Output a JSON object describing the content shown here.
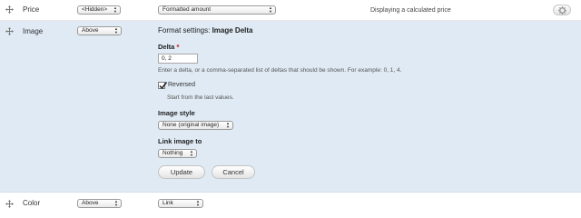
{
  "rows": {
    "price": {
      "label": "Price",
      "label_display": "<Hidden>",
      "formatter": "Formatted amount",
      "summary": "Displaying a calculated price",
      "settings_icon": "gear-icon"
    },
    "image": {
      "label": "Image",
      "label_display": "Above",
      "settings": {
        "heading_prefix": "Format settings: ",
        "heading_name": "Image Delta",
        "delta_label": "Delta",
        "required_mark": "*",
        "delta_value": "0, 2",
        "delta_description": "Enter a delta, or a comma-separated list of deltas that should be shown. For example: 0, 1, 4.",
        "reversed_label": "Reversed",
        "reversed_checked": true,
        "reversed_description": "Start from the last values.",
        "image_style_label": "Image style",
        "image_style_value": "None (original image)",
        "link_label": "Link image to",
        "link_value": "Nothing",
        "update_button": "Update",
        "cancel_button": "Cancel"
      }
    },
    "color": {
      "label": "Color",
      "label_display": "Above",
      "formatter": "Link"
    }
  },
  "icons": {
    "drag": "drag-handle-icon",
    "select_arrows": "select-arrows-icon",
    "checkmark": "checkmark-icon"
  },
  "colors": {
    "active_row_bg": "#dfeaf4",
    "required_mark": "#cc0000"
  }
}
